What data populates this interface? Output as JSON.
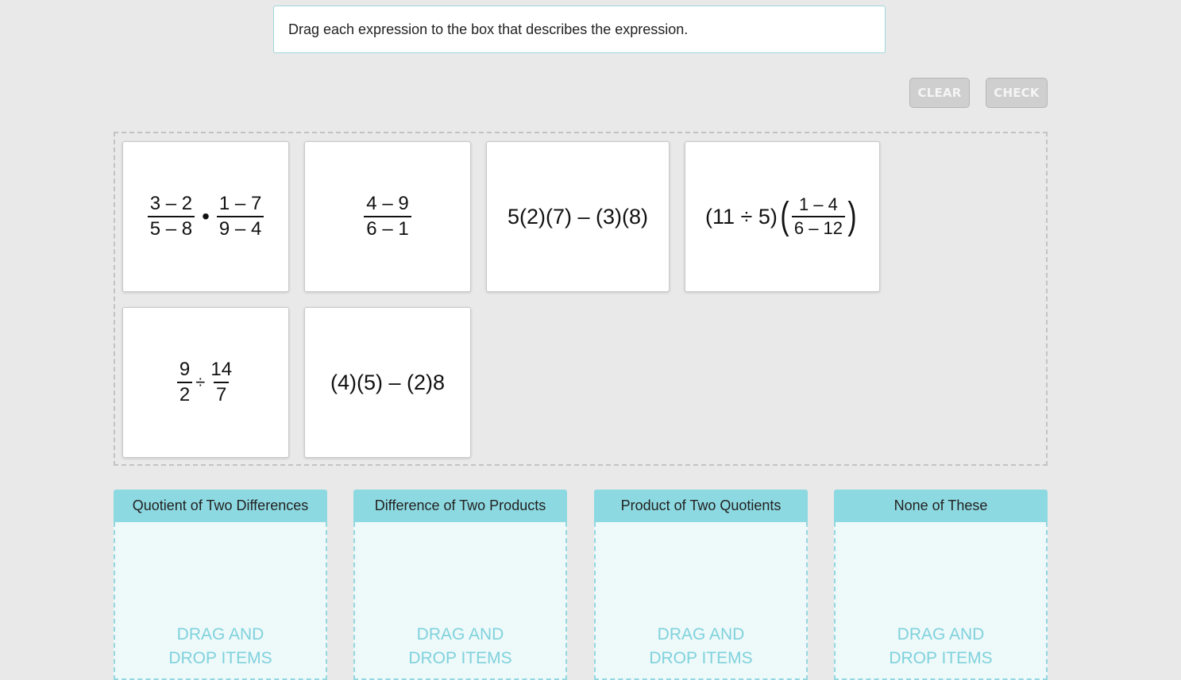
{
  "instruction": "Drag each expression to the box that describes the expression.",
  "buttons": {
    "clear": "CLEAR",
    "check": "CHECK"
  },
  "cards": [
    {
      "parts": {
        "f1n": "3 – 2",
        "f1d": "5 – 8",
        "op": "•",
        "f2n": "1 – 7",
        "f2d": "9 – 4"
      }
    },
    {
      "parts": {
        "f1n": "4 – 9",
        "f1d": "6 – 1"
      }
    },
    {
      "text": "5(2)(7) – (3)(8)"
    },
    {
      "parts": {
        "lead": "(11 ÷ 5)",
        "open": "(",
        "f1n": "1 – 4",
        "f1d": "6 – 12",
        "close": ")"
      }
    },
    {
      "parts": {
        "f1n": "9",
        "f1d": "2",
        "op": "÷",
        "f2n": "14",
        "f2d": "7"
      }
    },
    {
      "text": "(4)(5) – (2)8"
    }
  ],
  "zones": [
    {
      "label": "Quotient of Two Differences",
      "placeholder_line1": "DRAG AND",
      "placeholder_line2": "DROP ITEMS"
    },
    {
      "label": "Difference of Two Products",
      "placeholder_line1": "DRAG AND",
      "placeholder_line2": "DROP ITEMS"
    },
    {
      "label": "Product of Two Quotients",
      "placeholder_line1": "DRAG AND",
      "placeholder_line2": "DROP ITEMS"
    },
    {
      "label": "None of These",
      "placeholder_line1": "DRAG AND",
      "placeholder_line2": "DROP ITEMS"
    }
  ],
  "colors": {
    "zone_header": "#8dd9e1",
    "zone_text": "#7fd2dc",
    "background": "#e9e9e9"
  }
}
